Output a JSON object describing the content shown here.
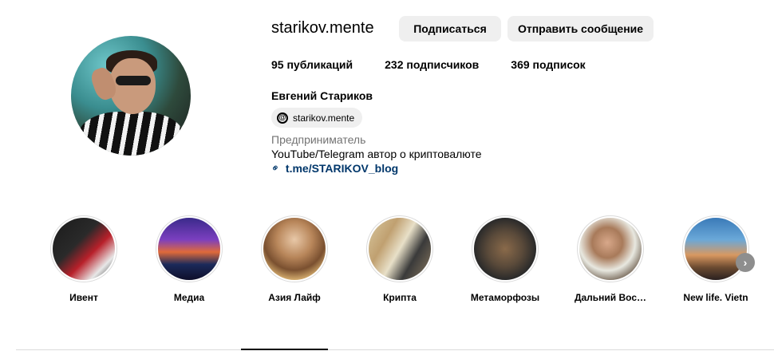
{
  "profile": {
    "username": "starikov.mente",
    "full_name": "Евгений Стариков",
    "category": "Предприниматель",
    "bio": "YouTube/Telegram автор о криптовалюте",
    "link": "t.me/STARIKOV_blog",
    "threads_handle": "starikov.mente"
  },
  "buttons": {
    "follow": "Подписаться",
    "message": "Отправить сообщение"
  },
  "stats": {
    "posts_num": "95",
    "posts_label": "публикаций",
    "followers_num": "232",
    "followers_label": "подписчиков",
    "following_num": "369",
    "following_label": "подписок"
  },
  "highlights": [
    {
      "label": "Ивент"
    },
    {
      "label": "Медиа"
    },
    {
      "label": "Азия Лайф"
    },
    {
      "label": "Крипта"
    },
    {
      "label": "Метаморфозы"
    },
    {
      "label": "Дальний Вос…"
    },
    {
      "label": "New life. Vietn"
    }
  ],
  "icons": {
    "threads": "threads-icon",
    "link": "link-icon",
    "next": "chevron-right-icon"
  },
  "colors": {
    "button_bg": "#efefef",
    "link": "#00376b",
    "muted": "#737373"
  }
}
